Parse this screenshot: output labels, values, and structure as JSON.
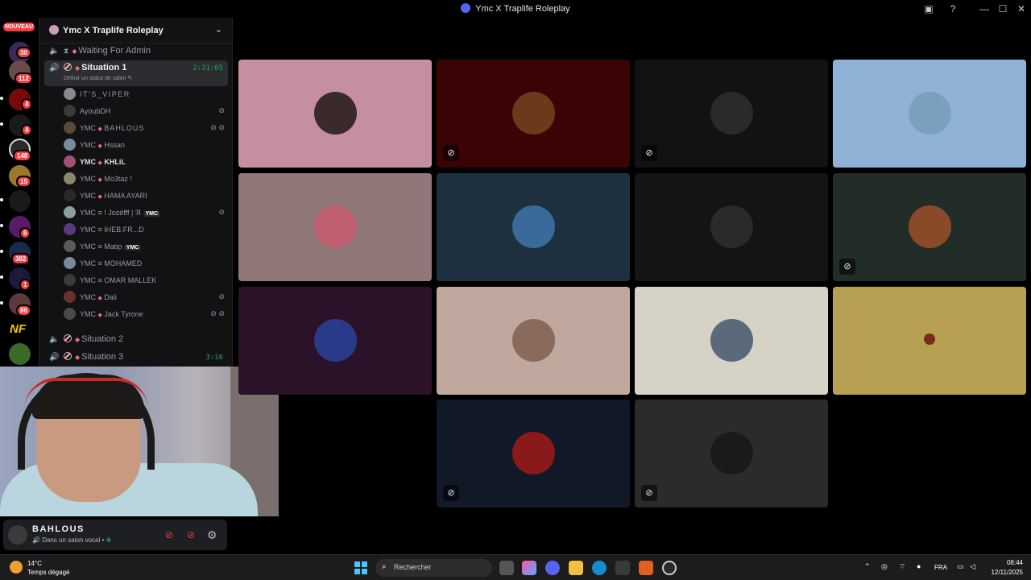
{
  "window": {
    "title": "Ymc X Traplife Roleplay"
  },
  "rail": {
    "nouveau": "NOUVEAU",
    "badges": [
      "30",
      "112",
      "4",
      "4",
      "148",
      "15",
      "6",
      "382",
      "1",
      "86"
    ],
    "nf": "NF"
  },
  "sidebar": {
    "server_name": "Ymc X Traplife Roleplay",
    "channels": {
      "waiting": "Waiting For Admin",
      "situation1": "Situation 1",
      "situation1_timer": "2:31:05",
      "situation1_status": "Définir un statut de salon",
      "situation2": "Situation 2",
      "situation3": "Situation 3",
      "situation3_timer": "3:16"
    },
    "members": [
      {
        "prefix": "",
        "name": "IT'S_VIPER",
        "color": "#8a8a8a",
        "status": ""
      },
      {
        "prefix": "",
        "name": "AyoubDH",
        "color": "#3a3a3a",
        "status": "⊘"
      },
      {
        "prefix": "YMC",
        "name": "BAHLOUS",
        "color": "#5a4a3a",
        "status": "⊘ ⊘"
      },
      {
        "prefix": "YMC",
        "name": "Hssan",
        "color": "#7a8aa0",
        "status": ""
      },
      {
        "prefix": "YMC",
        "name": "KHLiL",
        "color": "#a05070",
        "status": ""
      },
      {
        "prefix": "YMC",
        "name": "Mo3taz !",
        "color": "#8a8a6a",
        "status": ""
      },
      {
        "prefix": "YMC",
        "name": "HAMA AYARI",
        "color": "#2a2a2a",
        "status": ""
      },
      {
        "prefix": "YMC",
        "name": "! Jozéfff | ℜ",
        "color": "#8aa0a0",
        "status": "⊘",
        "tag": "YMC"
      },
      {
        "prefix": "YMC",
        "name": "IHEB.FR...D",
        "color": "#5a3a7a",
        "status": ""
      },
      {
        "prefix": "YMC",
        "name": "Matip",
        "color": "#5a5a5a",
        "status": "",
        "tag": "YMC"
      },
      {
        "prefix": "YMC",
        "name": "MOHAMED",
        "color": "#7a8a9a",
        "status": ""
      },
      {
        "prefix": "YMC",
        "name": "OMAR MALLEK",
        "color": "#3a3a3a",
        "status": ""
      },
      {
        "prefix": "YMC",
        "name": "Dali",
        "color": "#6a3030",
        "status": "⊘"
      },
      {
        "prefix": "YMC",
        "name": "Jack Tyrone",
        "color": "#4a4a4a",
        "status": "⊘ ⊘"
      }
    ]
  },
  "user_panel": {
    "username": "BAHLOUS",
    "status": "Dans un salon vocal •"
  },
  "grid": {
    "tiles": [
      {
        "bg": "#c48fa3",
        "pic": "#3a2a2a",
        "mute": ""
      },
      {
        "bg": "#3a0404",
        "pic": "#6a3a1a",
        "mute": "⊘"
      },
      {
        "bg": "#121212",
        "pic": "#2a2a2a",
        "mute": "⊘"
      },
      {
        "bg": "#8fb2d6",
        "pic": "#7aa0c0",
        "mute": ""
      },
      {
        "bg": "#917878",
        "pic": "#c06070",
        "mute": ""
      },
      {
        "bg": "#1e303f",
        "pic": "#3a6a9a",
        "mute": ""
      },
      {
        "bg": "#141414",
        "pic": "#2a2a2a",
        "mute": ""
      },
      {
        "bg": "#212d26",
        "pic": "#8a4a2a",
        "mute": "⊘"
      },
      {
        "bg": "#2a1228",
        "pic": "#2a3a8a",
        "mute": ""
      },
      {
        "bg": "#c0a89e",
        "pic": "#8a6a5a",
        "mute": ""
      },
      {
        "bg": "#d6d3c6",
        "pic": "#5a6a7a",
        "mute": ""
      },
      {
        "bg": "#b8a052",
        "pic": "#b8a052",
        "mute": ""
      },
      {
        "bg": "#111827",
        "pic": "#8a1a1a",
        "mute": "⊘"
      },
      {
        "bg": "#2b2b2b",
        "pic": "#1a1a1a",
        "mute": "⊘"
      }
    ]
  },
  "taskbar": {
    "temperature": "14°C",
    "condition": "Temps dégagé",
    "search_placeholder": "Rechercher",
    "language": "FRA",
    "time": "08:44",
    "date": "12/11/2025"
  }
}
